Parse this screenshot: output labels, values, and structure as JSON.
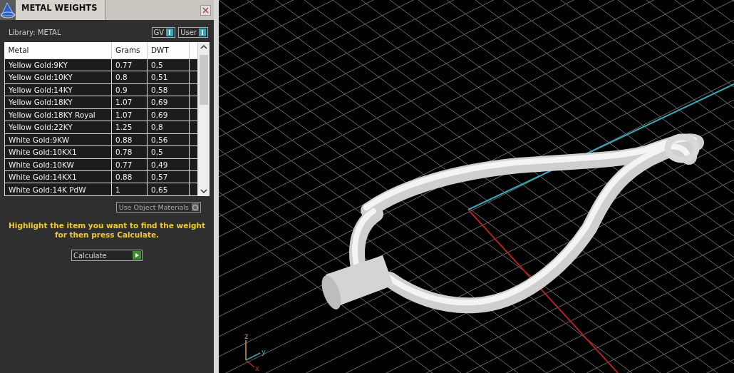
{
  "panel": {
    "title": "METAL WEIGHTS",
    "library_label": "Library: METAL",
    "toggles": [
      {
        "label": "GV",
        "on": true
      },
      {
        "label": "User",
        "on": true
      }
    ],
    "table": {
      "columns": [
        "Metal",
        "Grams",
        "DWT"
      ],
      "rows": [
        [
          "Yellow Gold:9KY",
          "0.77",
          "0,5"
        ],
        [
          "Yellow Gold:10KY",
          "0.8",
          "0,51"
        ],
        [
          "Yellow Gold:14KY",
          "0.9",
          "0,58"
        ],
        [
          "Yellow Gold:18KY",
          "1.07",
          "0,69"
        ],
        [
          "Yellow Gold:18KY Royal",
          "1.07",
          "0,69"
        ],
        [
          "Yellow Gold:22KY",
          "1.25",
          "0,8"
        ],
        [
          "White Gold:9KW",
          "0.88",
          "0,56"
        ],
        [
          "White Gold:10KX1",
          "0.78",
          "0,5"
        ],
        [
          "White Gold:10KW",
          "0.77",
          "0,49"
        ],
        [
          "White Gold:14KX1",
          "0.88",
          "0,57"
        ],
        [
          "White Gold:14K PdW",
          "1",
          "0,65"
        ]
      ]
    },
    "use_object_materials": {
      "label": "Use Object Materials",
      "on": false
    },
    "hint": "Highlight the item you want to find the weight for then press Calculate.",
    "calculate_button": "Calculate"
  },
  "viewport": {
    "axis_labels": [
      "z",
      "y",
      "x"
    ]
  }
}
